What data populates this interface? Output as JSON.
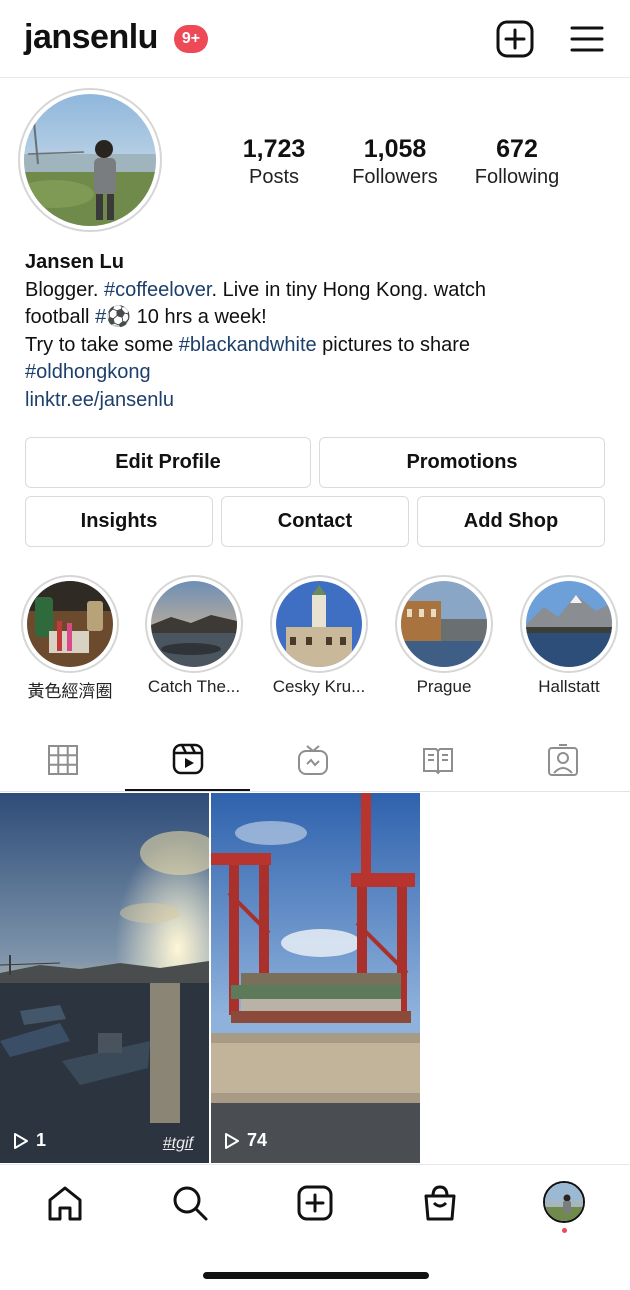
{
  "header": {
    "username": "jansenlu",
    "notification_badge": "9+",
    "icons": [
      "new-post-icon",
      "menu-icon"
    ],
    "accent_color": "#ed4956"
  },
  "profile": {
    "stats": {
      "posts_count": "1,723",
      "posts_label": "Posts",
      "followers_count": "1,058",
      "followers_label": "Followers",
      "following_count": "672",
      "following_label": "Following"
    },
    "name": "Jansen Lu",
    "bio": {
      "line1_a": "Blogger. ",
      "line1_tag": "#coffeelover",
      "line1_b": ". Live in tiny Hong Kong. watch",
      "line2_a": "football ",
      "line2_tag": "#⚽",
      "line2_b": "  10 hrs a week!",
      "line3_a": "Try to take some ",
      "line3_tag": "#blackandwhite",
      "line3_b": " pictures to share",
      "line4_tag": "#oldhongkong",
      "link": "linktr.ee/jansenlu"
    },
    "link_color": "#1d3f6b"
  },
  "buttons": {
    "edit_profile": "Edit Profile",
    "promotions": "Promotions",
    "insights": "Insights",
    "contact": "Contact",
    "add_shop": "Add Shop"
  },
  "highlights": [
    {
      "label": "黃色經濟圈"
    },
    {
      "label": "Catch The..."
    },
    {
      "label": "Cesky Kru..."
    },
    {
      "label": "Prague"
    },
    {
      "label": "Hallstatt"
    }
  ],
  "tabs": {
    "items": [
      "grid-icon",
      "reels-icon",
      "igtv-icon",
      "guides-icon",
      "tagged-icon"
    ],
    "active": "reels-icon"
  },
  "reels": [
    {
      "views": "1",
      "hashtag": "#tgif"
    },
    {
      "views": "74"
    }
  ],
  "bottom_nav": {
    "items": [
      "home-icon",
      "search-icon",
      "new-post-icon",
      "shop-icon",
      "profile-avatar"
    ],
    "active": "profile-avatar"
  }
}
